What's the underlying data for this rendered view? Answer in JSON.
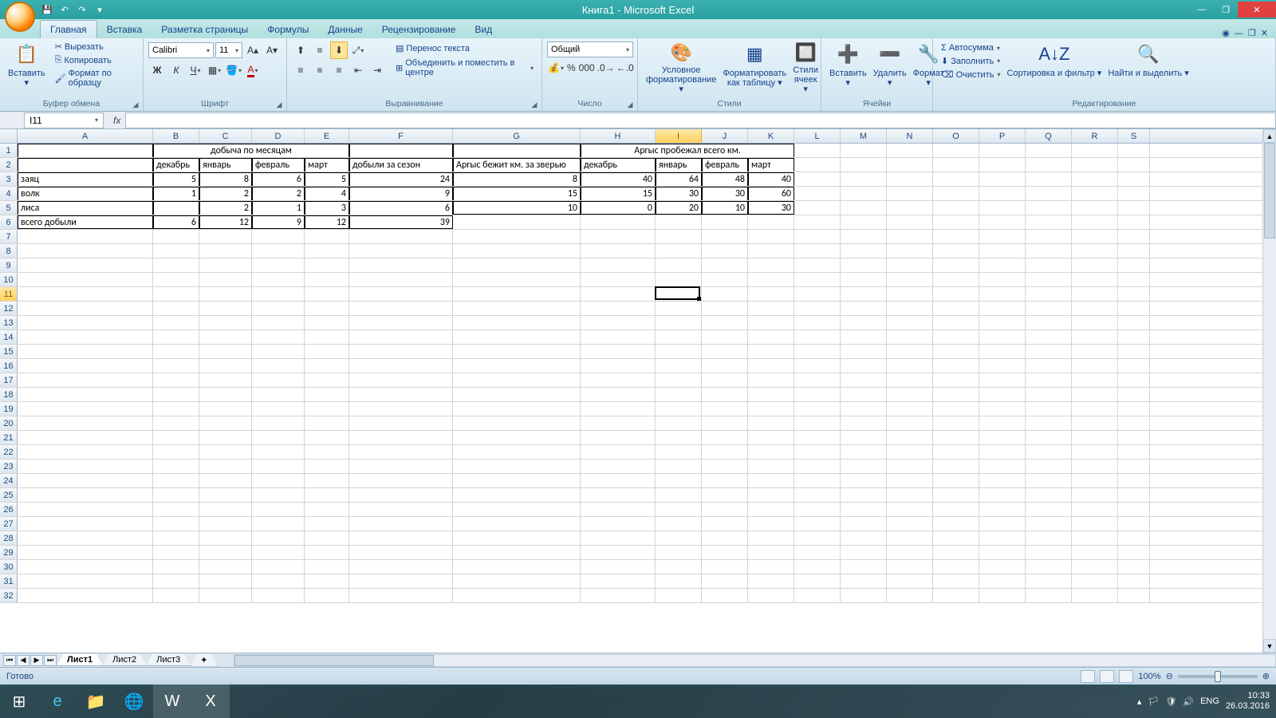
{
  "window": {
    "title": "Книга1 - Microsoft Excel"
  },
  "qat": {
    "save": "💾",
    "undo": "↶",
    "redo": "↷"
  },
  "tabs": [
    "Главная",
    "Вставка",
    "Разметка страницы",
    "Формулы",
    "Данные",
    "Рецензирование",
    "Вид"
  ],
  "active_tab": 0,
  "ribbon": {
    "clipboard": {
      "label": "Буфер обмена",
      "paste": "Вставить",
      "cut": "Вырезать",
      "copy": "Копировать",
      "format_painter": "Формат по образцу"
    },
    "font": {
      "label": "Шрифт",
      "name": "Calibri",
      "size": "11"
    },
    "alignment": {
      "label": "Выравнивание",
      "wrap": "Перенос текста",
      "merge": "Объединить и поместить в центре"
    },
    "number": {
      "label": "Число",
      "format": "Общий"
    },
    "styles": {
      "label": "Стили",
      "cond": "Условное форматирование",
      "table": "Форматировать как таблицу",
      "cell": "Стили ячеек"
    },
    "cells": {
      "label": "Ячейки",
      "insert": "Вставить",
      "delete": "Удалить",
      "format": "Формат"
    },
    "editing": {
      "label": "Редактирование",
      "autosum": "Автосумма",
      "fill": "Заполнить",
      "clear": "Очистить",
      "sort": "Сортировка и фильтр",
      "find": "Найти и выделить"
    }
  },
  "namebox": "I11",
  "formula": "",
  "columns": [
    "A",
    "B",
    "C",
    "D",
    "E",
    "F",
    "G",
    "H",
    "I",
    "J",
    "K",
    "L",
    "M",
    "N",
    "O",
    "P",
    "Q",
    "R",
    "S"
  ],
  "col_widths": {
    "A": 170,
    "B": 58,
    "C": 66,
    "D": 66,
    "E": 56,
    "F": 130,
    "G": 160,
    "H": 94,
    "I": 58,
    "J": 58,
    "K": 58,
    "L": 58,
    "M": 58,
    "N": 58,
    "O": 58,
    "P": 58,
    "Q": 58,
    "R": 58,
    "S": 40
  },
  "selected_col": "I",
  "selected_row": 11,
  "rows_visible": 32,
  "merges": [
    {
      "r": 1,
      "c1": "B",
      "c2": "E",
      "text": "добыча по месяцам"
    },
    {
      "r": 1,
      "c1": "H",
      "c2": "K",
      "text": "Аргыс пробежал всего км."
    }
  ],
  "data": {
    "1": {},
    "2": {
      "B": "декабрь",
      "C": "январь",
      "D": "февраль",
      "E": "март",
      "F": "добыли за сезон",
      "G": "Аргыс бежит км. за зверью",
      "H": "декабрь",
      "I": "январь",
      "J": "февраль",
      "K": "март"
    },
    "3": {
      "A": "заяц",
      "B": "5",
      "C": "8",
      "D": "6",
      "E": "5",
      "F": "24",
      "G": "8",
      "H": "40",
      "I": "64",
      "J": "48",
      "K": "40"
    },
    "4": {
      "A": "волк",
      "B": "1",
      "C": "2",
      "D": "2",
      "E": "4",
      "F": "9",
      "G": "15",
      "H": "15",
      "I": "30",
      "J": "30",
      "K": "60"
    },
    "5": {
      "A": "лиса",
      "B": "",
      "C": "2",
      "D": "1",
      "E": "3",
      "F": "6",
      "G": "10",
      "H": "0",
      "I": "20",
      "J": "10",
      "K": "30"
    },
    "6": {
      "A": "всего добыли",
      "B": "6",
      "C": "12",
      "D": "9",
      "E": "12",
      "F": "39"
    }
  },
  "numeric_cols": [
    "B",
    "C",
    "D",
    "E",
    "F",
    "G",
    "H",
    "I",
    "J",
    "K"
  ],
  "table_border": {
    "r1": 1,
    "r2": 6,
    "cols": [
      "A",
      "B",
      "C",
      "D",
      "E",
      "F",
      "G",
      "H",
      "I",
      "J",
      "K"
    ],
    "bottom_partial": {
      "6": [
        "A",
        "B",
        "C",
        "D",
        "E",
        "F"
      ]
    }
  },
  "sheets": [
    "Лист1",
    "Лист2",
    "Лист3"
  ],
  "active_sheet": 0,
  "status": {
    "ready": "Готово",
    "zoom": "100%"
  },
  "taskbar": {
    "lang": "ENG",
    "time": "10:33",
    "date": "26.03.2016"
  }
}
